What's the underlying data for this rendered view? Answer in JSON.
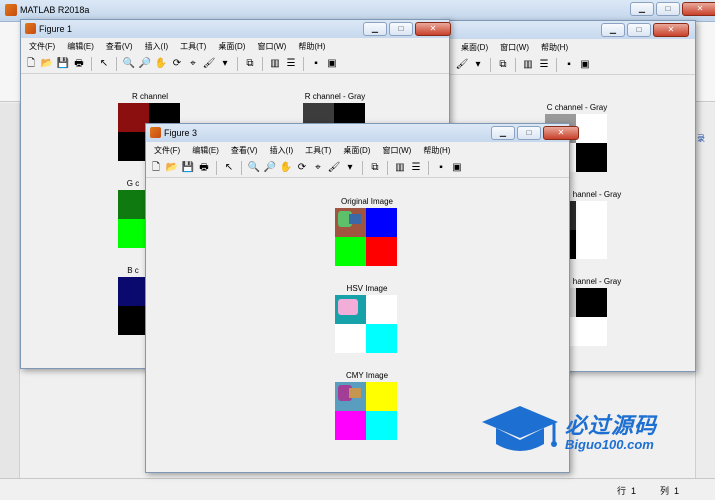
{
  "matlab": {
    "title": "MATLAB R2018a",
    "status_row_label": "行",
    "status_row_value": "1",
    "status_col_label": "列",
    "status_col_value": "1",
    "right_edge_text": "录"
  },
  "figure1": {
    "title": "Figure 1",
    "menus": [
      "文件(F)",
      "编辑(E)",
      "查看(V)",
      "插入(I)",
      "工具(T)",
      "桌面(D)",
      "窗口(W)",
      "帮助(H)"
    ],
    "plots": {
      "r_channel": "R channel",
      "r_channel_gray": "R channel - Gray",
      "g_channel": "G c",
      "b_channel": "B c",
      "c_channel_gray": "C channel - Gray",
      "m_channel_gray": "hannel - Gray",
      "y_channel_gray": "hannel - Gray"
    }
  },
  "figure_back": {
    "menus": [
      "桌面(D)",
      "窗口(W)",
      "帮助(H)"
    ]
  },
  "figure3": {
    "title": "Figure 3",
    "menus": [
      "文件(F)",
      "编辑(E)",
      "查看(V)",
      "插入(I)",
      "工具(T)",
      "桌面(D)",
      "窗口(W)",
      "帮助(H)"
    ],
    "plots": {
      "original": "Original Image",
      "hsv": "HSV Image",
      "cmy": "CMY Image"
    }
  },
  "watermark": {
    "line1": "必过源码",
    "line2": "Biguo100.com"
  },
  "colors": {
    "red": "#ff0000",
    "green": "#00ff00",
    "blue": "#0000ff",
    "cyan": "#00ffff",
    "magenta": "#ff00ff",
    "yellow": "#ffff00",
    "white": "#ffffff",
    "black": "#000000"
  }
}
